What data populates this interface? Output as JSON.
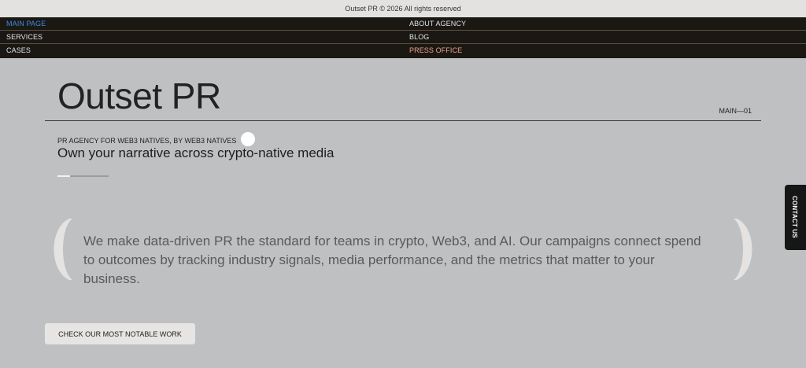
{
  "topbar": {
    "copyright": "Outset PR © 2026 All rights reserved"
  },
  "nav": {
    "main_page": "MAIN PAGE",
    "about": "ABOUT AGENCY",
    "services": "SERVICES",
    "blog": "BLOG",
    "cases": "CASES",
    "press": "PRESS OFFICE",
    "active_color": "#3d8be6",
    "press_color": "#e9a38b"
  },
  "hero": {
    "title": "Outset PR",
    "section_code": "MAIN—01",
    "eyebrow": "PR AGENCY FOR WEB3 NATIVES, BY WEB3 NATIVES",
    "tagline": "Own your narrative across crypto-native media",
    "slider_progress": 0.25
  },
  "quote": {
    "text": "We make data-driven PR the standard for teams in crypto, Web3, and AI. Our campaigns connect spend to outcomes by tracking industry signals, media performance, and the metrics that matter to your business."
  },
  "cta": {
    "label": "CHECK OUR MOST NOTABLE WORK"
  },
  "contact": {
    "label": "CONTACT US"
  }
}
